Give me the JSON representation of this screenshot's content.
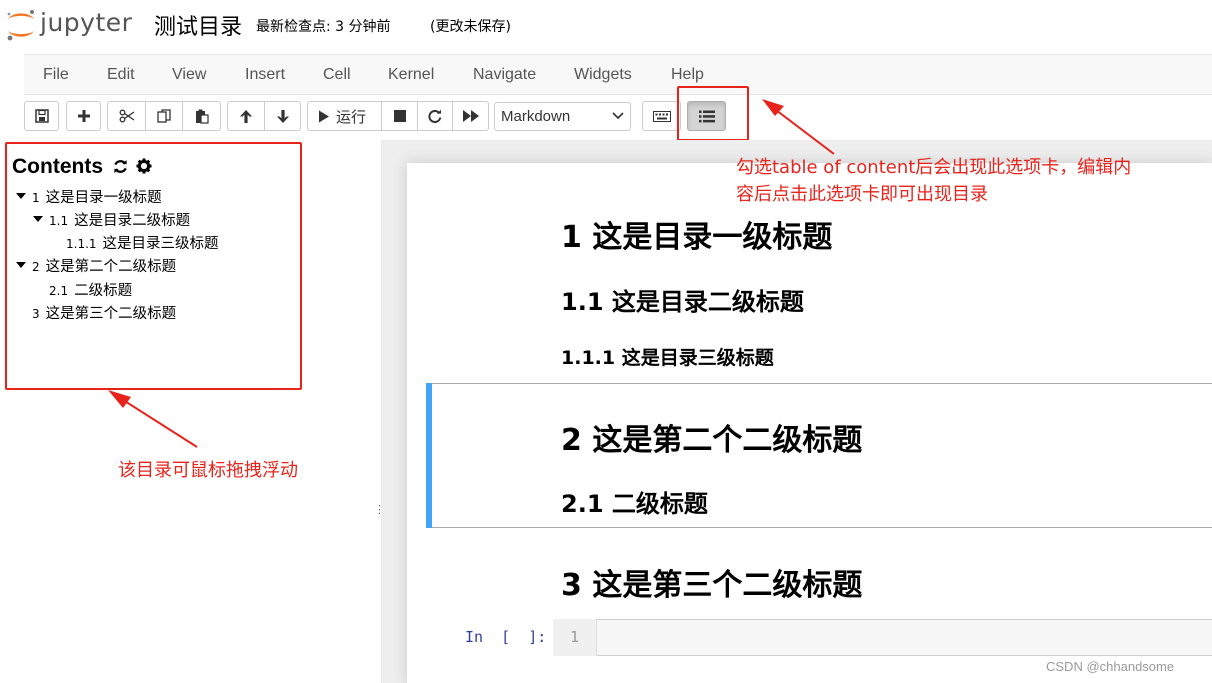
{
  "header": {
    "logo_text": "jupyter",
    "notebook_title": "测试目录",
    "checkpoint": "最新检查点: 3 分钟前",
    "autosave_status": "(更改未保存)"
  },
  "menu": [
    "File",
    "Edit",
    "View",
    "Insert",
    "Cell",
    "Kernel",
    "Navigate",
    "Widgets",
    "Help"
  ],
  "toolbar": {
    "run_label": "运行",
    "cell_type": "Markdown",
    "icons": [
      "save-icon",
      "plus-icon",
      "cut-icon",
      "copy-icon",
      "paste-icon",
      "arrow-up-icon",
      "arrow-down-icon",
      "run-icon",
      "stop-icon",
      "restart-icon",
      "fast-forward-icon",
      "keyboard-icon",
      "list-icon"
    ]
  },
  "toc": {
    "title": "Contents",
    "items": [
      {
        "num": "1",
        "text": "这是目录一级标题"
      },
      {
        "num": "1.1",
        "text": "这是目录二级标题"
      },
      {
        "num": "1.1.1",
        "text": "这是目录三级标题"
      },
      {
        "num": "2",
        "text": "这是第二个二级标题"
      },
      {
        "num": "2.1",
        "text": "二级标题"
      },
      {
        "num": "3",
        "text": "这是第三个二级标题"
      }
    ]
  },
  "notebook": {
    "headings": [
      "1  这是目录一级标题",
      "1.1  这是目录二级标题",
      "1.1.1  这是目录三级标题",
      "2  这是第二个二级标题",
      "2.1  二级标题",
      "3  这是第三个二级标题"
    ],
    "code_prompt": "In  [  ]:",
    "code_line_number": "1"
  },
  "annotations": {
    "toc_button_note": "勾选table of content后会出现此选项卡，编辑内容后点击此选项卡即可出现目录",
    "toc_button_note_line1": "勾选table of content后会出现此选项卡，编辑内",
    "toc_button_note_line2": "容后点击此选项卡即可出现目录",
    "toc_panel_note": "该目录可鼠标拖拽浮动"
  },
  "watermark": "CSDN @chhandsome",
  "colors": {
    "annotation_red": "#e8231b",
    "selected_cell_blue": "#42a5f5",
    "prompt_blue": "#303f9f",
    "jupyter_orange": "#f37726"
  }
}
